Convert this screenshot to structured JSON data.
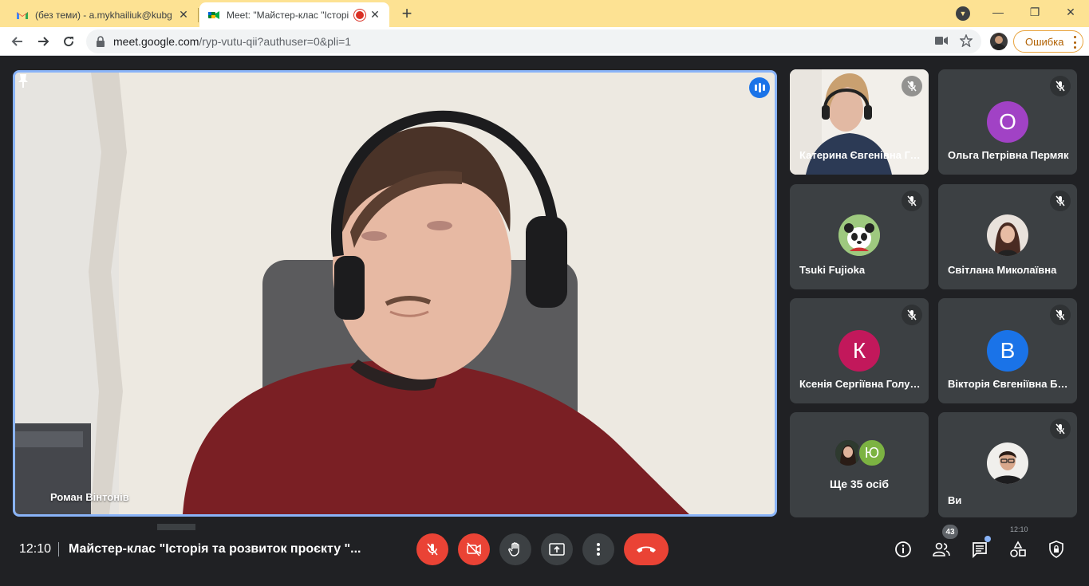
{
  "browser": {
    "tabs": [
      {
        "title": "(без теми) - a.mykhailiuk@kubg.",
        "favicon": "gmail-icon"
      },
      {
        "title": "Meet: \"Майстер-клас \"Історі",
        "favicon": "meet-icon",
        "recording": true
      }
    ],
    "url": {
      "host": "meet.google.com",
      "path": "/ryp-vutu-qii?authuser=0&pli=1"
    },
    "error_button": "Ошибка"
  },
  "meet": {
    "main_speaker": {
      "name": "Роман Вінтонів"
    },
    "participants": [
      {
        "name": "Катерина Євгенівна Гулько",
        "type": "video"
      },
      {
        "name": "Ольга Петрівна Пермяк",
        "initial": "О",
        "color": "#a142c5"
      },
      {
        "name": "Tsuki Fujioka",
        "type": "photo"
      },
      {
        "name": "Світлана Миколаївна",
        "type": "photo"
      },
      {
        "name": "Ксенія Сергіївна Голубенко",
        "initial": "К",
        "color": "#c2185b"
      },
      {
        "name": "Вікторія Євгеніївна Бойко",
        "initial": "В",
        "color": "#1a73e8"
      }
    ],
    "more": {
      "label": "Ще 35 осіб",
      "initial": "Ю"
    },
    "self": {
      "name": "Ви"
    },
    "bottom": {
      "time": "12:10",
      "title": "Майстер-клас \"Історія та розвиток проєкту \"...",
      "participants_count": "43"
    }
  },
  "taskbar": {
    "time": "12:10"
  }
}
